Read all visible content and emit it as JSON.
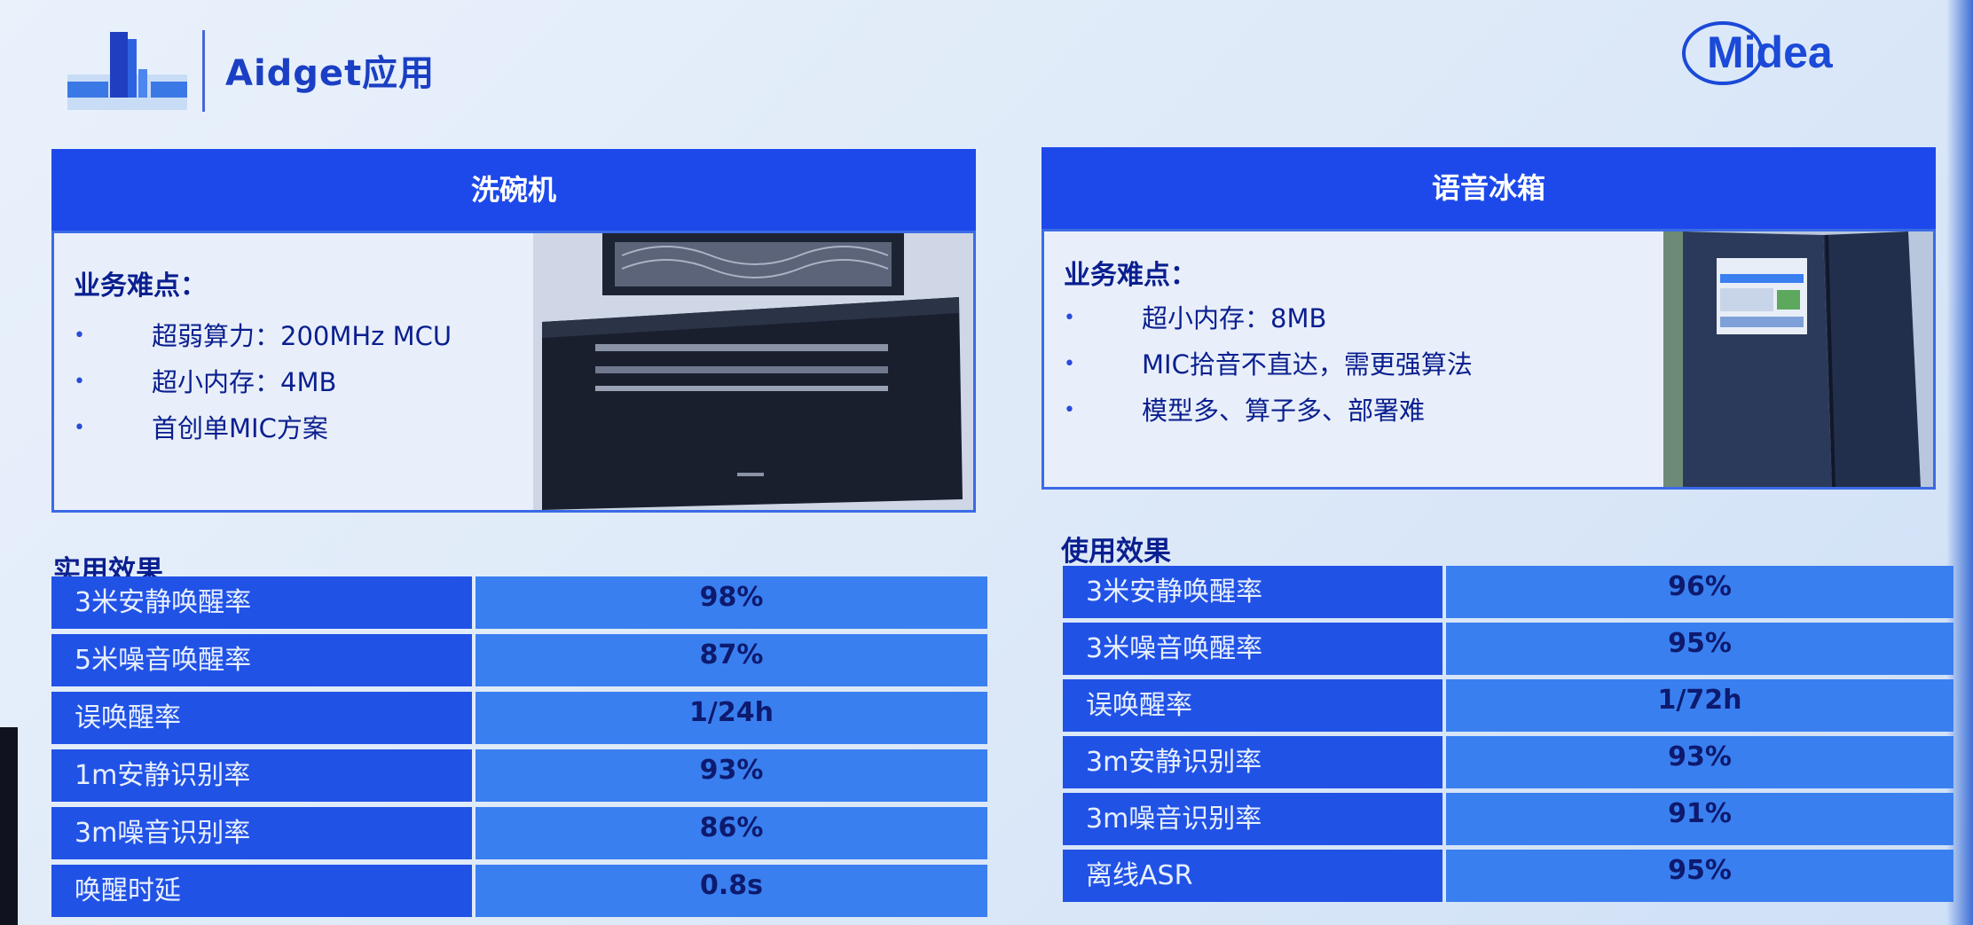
{
  "header": {
    "app_title": "Aidget应用",
    "brand": "Midea"
  },
  "colors": {
    "panel_header": "#1d49ea",
    "metric_cell": "#2152e6",
    "value_cell": "#3a7ff0",
    "text_dark": "#0a1f8f"
  },
  "left_panel": {
    "title": "洗碗机",
    "pain_points_title": "业务难点：",
    "pain_points": [
      "超弱算力：200MHz MCU",
      "超小内存：4MB",
      "首创单MIC方案"
    ],
    "image_icon": "dishwasher-image",
    "results_title": "实用效果",
    "results": [
      {
        "metric": "3米安静唤醒率",
        "value": "98%"
      },
      {
        "metric": "5米噪音唤醒率",
        "value": "87%"
      },
      {
        "metric": "误唤醒率",
        "value": "1/24h"
      },
      {
        "metric": "1m安静识别率",
        "value": "93%"
      },
      {
        "metric": "3m噪音识别率",
        "value": "86%"
      },
      {
        "metric": "唤醒时延",
        "value": "0.8s"
      }
    ]
  },
  "right_panel": {
    "title": "语音冰箱",
    "pain_points_title": "业务难点：",
    "pain_points": [
      "超小内存：8MB",
      "MIC拾音不直达，需更强算法",
      "模型多、算子多、部署难"
    ],
    "image_icon": "refrigerator-image",
    "results_title": "使用效果",
    "results": [
      {
        "metric": "3米安静唤醒率",
        "value": "96%"
      },
      {
        "metric": "3米噪音唤醒率",
        "value": "95%"
      },
      {
        "metric": "误唤醒率",
        "value": "1/72h"
      },
      {
        "metric": "3m安静识别率",
        "value": "93%"
      },
      {
        "metric": "3m噪音识别率",
        "value": "91%"
      },
      {
        "metric": "离线ASR",
        "value": "95%"
      }
    ]
  }
}
